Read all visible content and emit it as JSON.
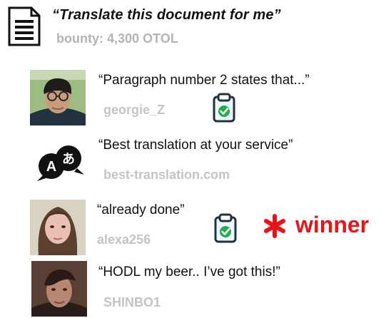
{
  "request": {
    "title": "“Translate this document for me”",
    "bounty": "bounty: 4,300 OTOL"
  },
  "responses": [
    {
      "message": "“Paragraph number 2 states that...”",
      "user": "georgie_Z",
      "avatar": "man-with-glasses-photo",
      "verified": true
    },
    {
      "message": "“Best translation at your service”",
      "user": "best-translation.com",
      "avatar": "translation-logo-icon",
      "logo_letters": {
        "latin": "A",
        "japanese": "あ"
      },
      "verified": false
    },
    {
      "message": "“already done”",
      "user": "alexa256",
      "avatar": "woman-portrait-photo",
      "verified": true,
      "badge": "winner"
    },
    {
      "message": "“HODL my beer.. I’ve got this!”",
      "user": "SHINBO1",
      "avatar": "man-portrait-photo",
      "verified": false
    }
  ],
  "icons": {
    "document": "document-icon",
    "verified": "clipboard-check-icon",
    "winner": "asterisk-star-icon"
  },
  "colors": {
    "text": "#111111",
    "muted": "#c4c4c4",
    "winner": "#e81419",
    "verified_green": "#20ad4a",
    "clipboard_border": "#20323d",
    "clipboard_fill": "#eef7ff"
  }
}
